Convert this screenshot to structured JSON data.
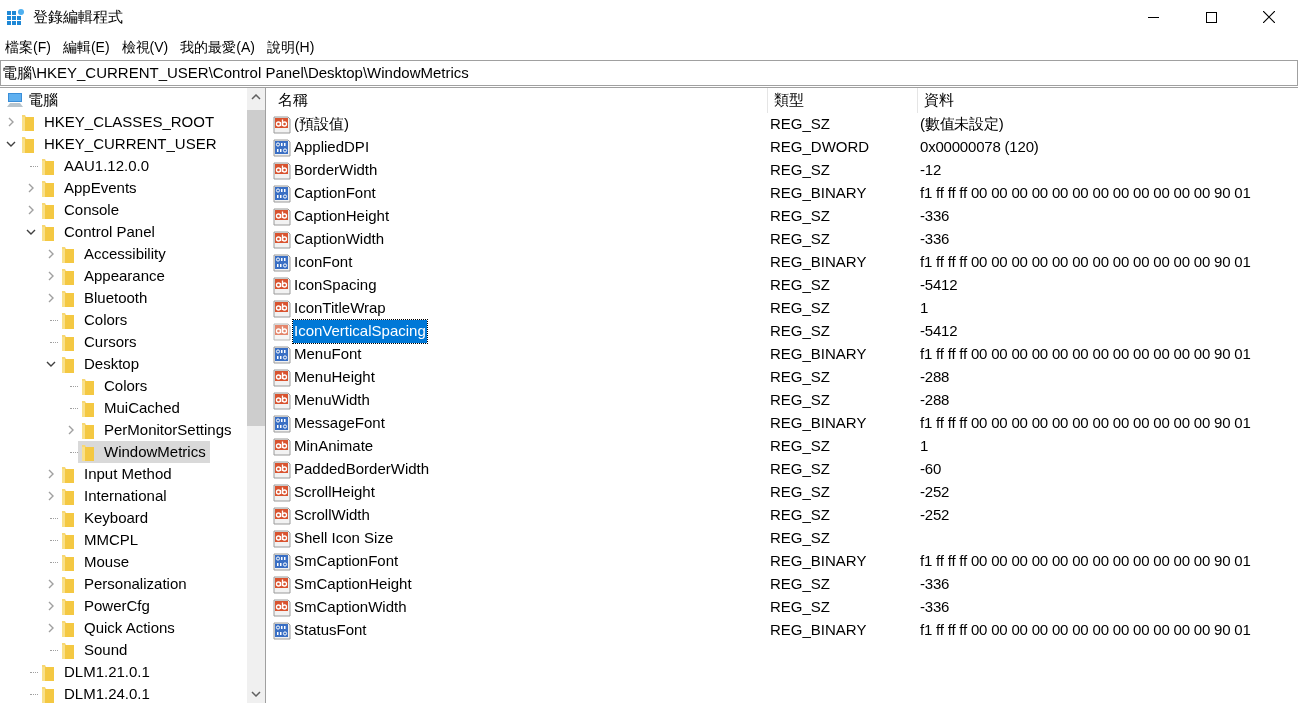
{
  "window": {
    "title": "登錄編輯程式"
  },
  "menu": [
    "檔案(F)",
    "編輯(E)",
    "檢視(V)",
    "我的最愛(A)",
    "說明(H)"
  ],
  "address": "電腦\\HKEY_CURRENT_USER\\Control Panel\\Desktop\\WindowMetrics",
  "tree": {
    "label": "電腦",
    "selected": false,
    "children": [
      {
        "label": "HKEY_CLASSES_ROOT",
        "expanded": false,
        "selected": false
      },
      {
        "label": "HKEY_CURRENT_USER",
        "expanded": true,
        "selected": false,
        "children": [
          {
            "label": "AAU1.12.0.0",
            "selected": false
          },
          {
            "label": "AppEvents",
            "expanded": false,
            "selected": false
          },
          {
            "label": "Console",
            "expanded": false,
            "selected": false
          },
          {
            "label": "Control Panel",
            "expanded": true,
            "selected": false,
            "children": [
              {
                "label": "Accessibility",
                "expanded": false,
                "selected": false
              },
              {
                "label": "Appearance",
                "expanded": false,
                "selected": false
              },
              {
                "label": "Bluetooth",
                "expanded": false,
                "selected": false
              },
              {
                "label": "Colors",
                "selected": false
              },
              {
                "label": "Cursors",
                "selected": false
              },
              {
                "label": "Desktop",
                "expanded": true,
                "selected": false,
                "children": [
                  {
                    "label": "Colors",
                    "selected": false
                  },
                  {
                    "label": "MuiCached",
                    "selected": false
                  },
                  {
                    "label": "PerMonitorSettings",
                    "expanded": false,
                    "selected": false
                  },
                  {
                    "label": "WindowMetrics",
                    "selected": true
                  }
                ]
              },
              {
                "label": "Input Method",
                "expanded": false,
                "selected": false
              },
              {
                "label": "International",
                "expanded": false,
                "selected": false
              },
              {
                "label": "Keyboard",
                "selected": false
              },
              {
                "label": "MMCPL",
                "selected": false
              },
              {
                "label": "Mouse",
                "selected": false
              },
              {
                "label": "Personalization",
                "expanded": false,
                "selected": false
              },
              {
                "label": "PowerCfg",
                "expanded": false,
                "selected": false
              },
              {
                "label": "Quick Actions",
                "expanded": false,
                "selected": false
              },
              {
                "label": "Sound",
                "selected": false
              }
            ]
          },
          {
            "label": "DLM1.21.0.1",
            "selected": false
          },
          {
            "label": "DLM1.24.0.1",
            "selected": false
          }
        ]
      }
    ]
  },
  "table": {
    "columns": [
      "名稱",
      "類型",
      "資料"
    ],
    "rows": [
      {
        "kind": "string",
        "name": "(預設值)",
        "type": "REG_SZ",
        "data": "(數值未設定)",
        "selected": false
      },
      {
        "kind": "binary",
        "name": "AppliedDPI",
        "type": "REG_DWORD",
        "data": "0x00000078 (120)",
        "selected": false
      },
      {
        "kind": "string",
        "name": "BorderWidth",
        "type": "REG_SZ",
        "data": "-12",
        "selected": false
      },
      {
        "kind": "binary",
        "name": "CaptionFont",
        "type": "REG_BINARY",
        "data": "f1 ff ff ff 00 00 00 00 00 00 00 00 00 00 00 00 90 01",
        "selected": false
      },
      {
        "kind": "string",
        "name": "CaptionHeight",
        "type": "REG_SZ",
        "data": "-336",
        "selected": false
      },
      {
        "kind": "string",
        "name": "CaptionWidth",
        "type": "REG_SZ",
        "data": "-336",
        "selected": false
      },
      {
        "kind": "binary",
        "name": "IconFont",
        "type": "REG_BINARY",
        "data": "f1 ff ff ff 00 00 00 00 00 00 00 00 00 00 00 00 90 01",
        "selected": false
      },
      {
        "kind": "string",
        "name": "IconSpacing",
        "type": "REG_SZ",
        "data": "-5412",
        "selected": false
      },
      {
        "kind": "string",
        "name": "IconTitleWrap",
        "type": "REG_SZ",
        "data": "1",
        "selected": false
      },
      {
        "kind": "string",
        "name": "IconVerticalSpacing",
        "type": "REG_SZ",
        "data": "-5412",
        "selected": true
      },
      {
        "kind": "binary",
        "name": "MenuFont",
        "type": "REG_BINARY",
        "data": "f1 ff ff ff 00 00 00 00 00 00 00 00 00 00 00 00 90 01",
        "selected": false
      },
      {
        "kind": "string",
        "name": "MenuHeight",
        "type": "REG_SZ",
        "data": "-288",
        "selected": false
      },
      {
        "kind": "string",
        "name": "MenuWidth",
        "type": "REG_SZ",
        "data": "-288",
        "selected": false
      },
      {
        "kind": "binary",
        "name": "MessageFont",
        "type": "REG_BINARY",
        "data": "f1 ff ff ff 00 00 00 00 00 00 00 00 00 00 00 00 90 01",
        "selected": false
      },
      {
        "kind": "string",
        "name": "MinAnimate",
        "type": "REG_SZ",
        "data": "1",
        "selected": false
      },
      {
        "kind": "string",
        "name": "PaddedBorderWidth",
        "type": "REG_SZ",
        "data": "-60",
        "selected": false
      },
      {
        "kind": "string",
        "name": "ScrollHeight",
        "type": "REG_SZ",
        "data": "-252",
        "selected": false
      },
      {
        "kind": "string",
        "name": "ScrollWidth",
        "type": "REG_SZ",
        "data": "-252",
        "selected": false
      },
      {
        "kind": "string",
        "name": "Shell Icon Size",
        "type": "REG_SZ",
        "selected": false
      },
      {
        "kind": "binary",
        "name": "SmCaptionFont",
        "type": "REG_BINARY",
        "data": "f1 ff ff ff 00 00 00 00 00 00 00 00 00 00 00 00 90 01",
        "selected": false
      },
      {
        "kind": "string",
        "name": "SmCaptionHeight",
        "type": "REG_SZ",
        "data": "-336",
        "selected": false
      },
      {
        "kind": "string",
        "name": "SmCaptionWidth",
        "type": "REG_SZ",
        "data": "-336",
        "selected": false
      },
      {
        "kind": "binary",
        "name": "StatusFont",
        "type": "REG_BINARY",
        "data": "f1 ff ff ff 00 00 00 00 00 00 00 00 00 00 00 00 90 01",
        "selected": false
      }
    ]
  }
}
